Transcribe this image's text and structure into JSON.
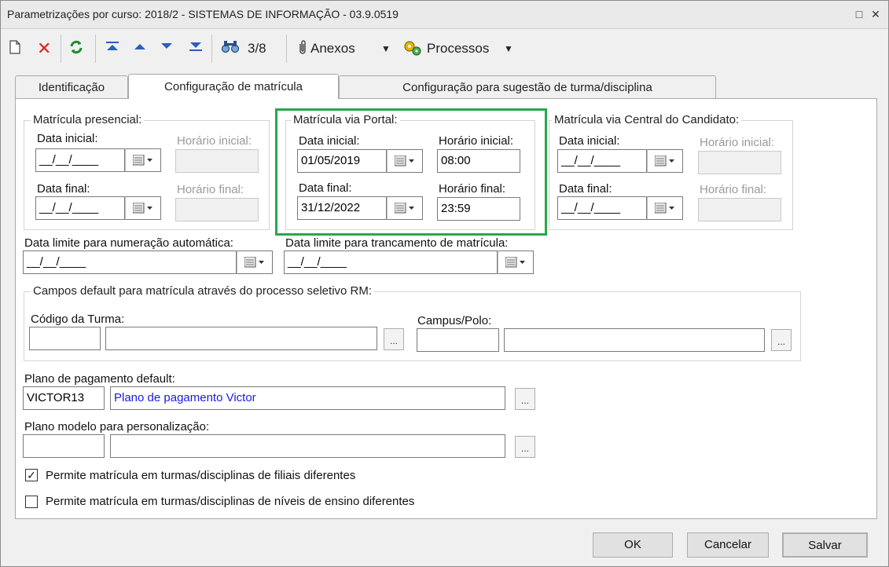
{
  "window": {
    "title": "Parametrizações por curso: 2018/2 - SISTEMAS DE INFORMAÇÃO - 03.9.0519"
  },
  "toolbar": {
    "record_counter": "3/8",
    "anexos_label": "Anexos",
    "processos_label": "Processos"
  },
  "tabs": [
    {
      "label": "Identificação"
    },
    {
      "label": "Configuração de matrícula"
    },
    {
      "label": "Configuração para sugestão de turma/disciplina"
    }
  ],
  "presencial": {
    "legend": "Matrícula presencial:",
    "data_inicial_label": "Data inicial:",
    "data_inicial_value": "__/__/____",
    "horario_inicial_label": "Horário inicial:",
    "data_final_label": "Data final:",
    "data_final_value": "__/__/____",
    "horario_final_label": "Horário final:"
  },
  "portal": {
    "legend": "Matrícula via Portal:",
    "data_inicial_label": "Data inicial:",
    "data_inicial_value": "01/05/2019",
    "horario_inicial_label": "Horário inicial:",
    "horario_inicial_value": "08:00",
    "data_final_label": "Data final:",
    "data_final_value": "31/12/2022",
    "horario_final_label": "Horário final:",
    "horario_final_value": "23:59"
  },
  "central": {
    "legend": "Matrícula via Central do Candidato:",
    "data_inicial_label": "Data inicial:",
    "data_inicial_value": "__/__/____",
    "horario_inicial_label": "Horário inicial:",
    "data_final_label": "Data final:",
    "data_final_value": "__/__/____",
    "horario_final_label": "Horário final:"
  },
  "limites": {
    "numeracao_label": "Data limite para numeração automática:",
    "numeracao_value": "__/__/____",
    "trancamento_label": "Data limite para trancamento de matrícula:",
    "trancamento_value": "__/__/____"
  },
  "processo_seletivo": {
    "legend": "Campos default para matrícula através do processo seletivo RM:",
    "turma_label": "Código da Turma:",
    "campus_label": "Campus/Polo:",
    "ellipsis": "..."
  },
  "plano_pagamento": {
    "label": "Plano de pagamento default:",
    "code": "VICTOR13",
    "description": "Plano de pagamento Victor"
  },
  "plano_modelo": {
    "label": "Plano modelo para personalização:"
  },
  "checkboxes": [
    {
      "label": "Permite matrícula em turmas/disciplinas de filiais diferentes",
      "checked": true
    },
    {
      "label": "Permite matrícula em turmas/disciplinas de níveis de ensino diferentes",
      "checked": false
    }
  ],
  "buttons": {
    "ok": "OK",
    "cancelar": "Cancelar",
    "salvar": "Salvar"
  },
  "colors": {
    "highlight": "#27a94a",
    "link_text": "#1a1ae6"
  }
}
